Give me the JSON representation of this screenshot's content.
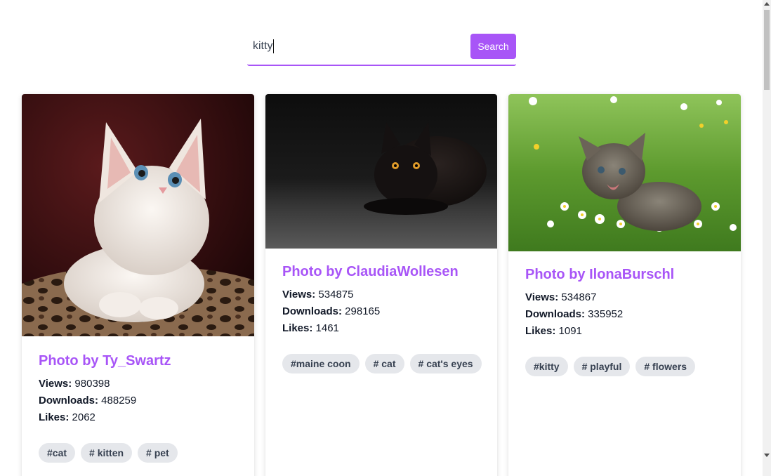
{
  "search": {
    "value": "kitty",
    "button_label": "Search"
  },
  "stat_labels": {
    "views": "Views:",
    "downloads": "Downloads:",
    "likes": "Likes:"
  },
  "cards": [
    {
      "title": "Photo by Ty_Swartz",
      "image": "white-kitten-photo",
      "views": "980398",
      "downloads": "488259",
      "likes": "2062",
      "tags": [
        "#cat",
        "# kitten",
        "# pet"
      ]
    },
    {
      "title": "Photo by ClaudiaWollesen",
      "image": "black-cat-photo",
      "views": "534875",
      "downloads": "298165",
      "likes": "1461",
      "tags": [
        "#maine coon",
        "# cat",
        "# cat's eyes"
      ]
    },
    {
      "title": "Photo by IlonaBurschl",
      "image": "tabby-kitten-in-flowers-photo",
      "views": "534867",
      "downloads": "335952",
      "likes": "1091",
      "tags": [
        "#kitty",
        "# playful",
        "# flowers"
      ]
    }
  ],
  "colors": {
    "accent": "#a855f7",
    "tag_bg": "#e5e7eb",
    "tag_text": "#374151"
  }
}
